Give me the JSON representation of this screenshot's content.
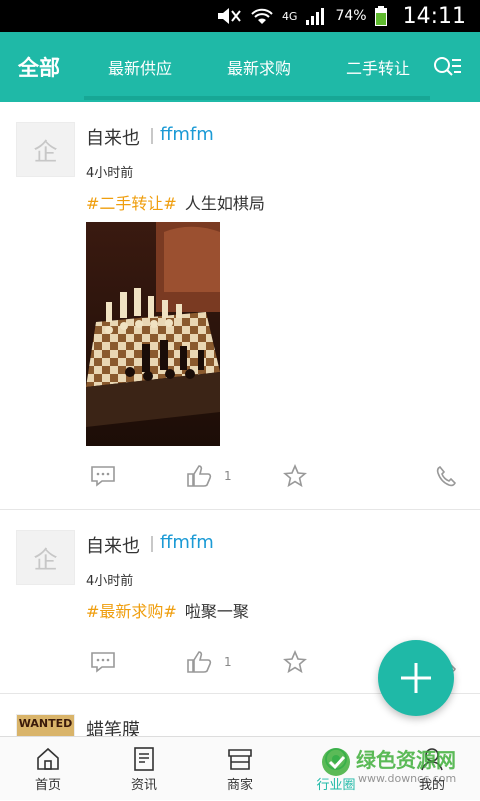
{
  "status_bar": {
    "network": "4G",
    "battery": "74%",
    "time": "14:11"
  },
  "tabs": [
    {
      "label": "全部",
      "active": true
    },
    {
      "label": "最新供应",
      "active": false
    },
    {
      "label": "最新求购",
      "active": false
    },
    {
      "label": "二手转让",
      "active": false
    }
  ],
  "posts": [
    {
      "avatar_char": "企",
      "name": "自来也",
      "company": "ffmfm",
      "time": "4小时前",
      "tag": "#二手转让#",
      "text": "人生如棋局",
      "has_image": true,
      "like_count": "1"
    },
    {
      "avatar_char": "企",
      "name": "自来也",
      "company": "ffmfm",
      "time": "4小时前",
      "tag": "#最新求购#",
      "text": "啦聚一聚",
      "has_image": false,
      "like_count": "1"
    },
    {
      "avatar_text": "WANTED",
      "name": "蜡笔膜"
    }
  ],
  "bottom_nav": [
    {
      "label": "首页",
      "icon": "home-icon"
    },
    {
      "label": "资讯",
      "icon": "news-icon"
    },
    {
      "label": "商家",
      "icon": "store-icon"
    },
    {
      "label": "行业圈",
      "icon": "circle-icon",
      "active": true
    },
    {
      "label": "我的",
      "icon": "profile-icon"
    }
  ],
  "watermark": {
    "text": "绿色资源网",
    "url": "www.downcc.com"
  },
  "colors": {
    "accent": "#1fb9a7",
    "tag": "#ef9e0e",
    "link": "#1b9ad5"
  }
}
